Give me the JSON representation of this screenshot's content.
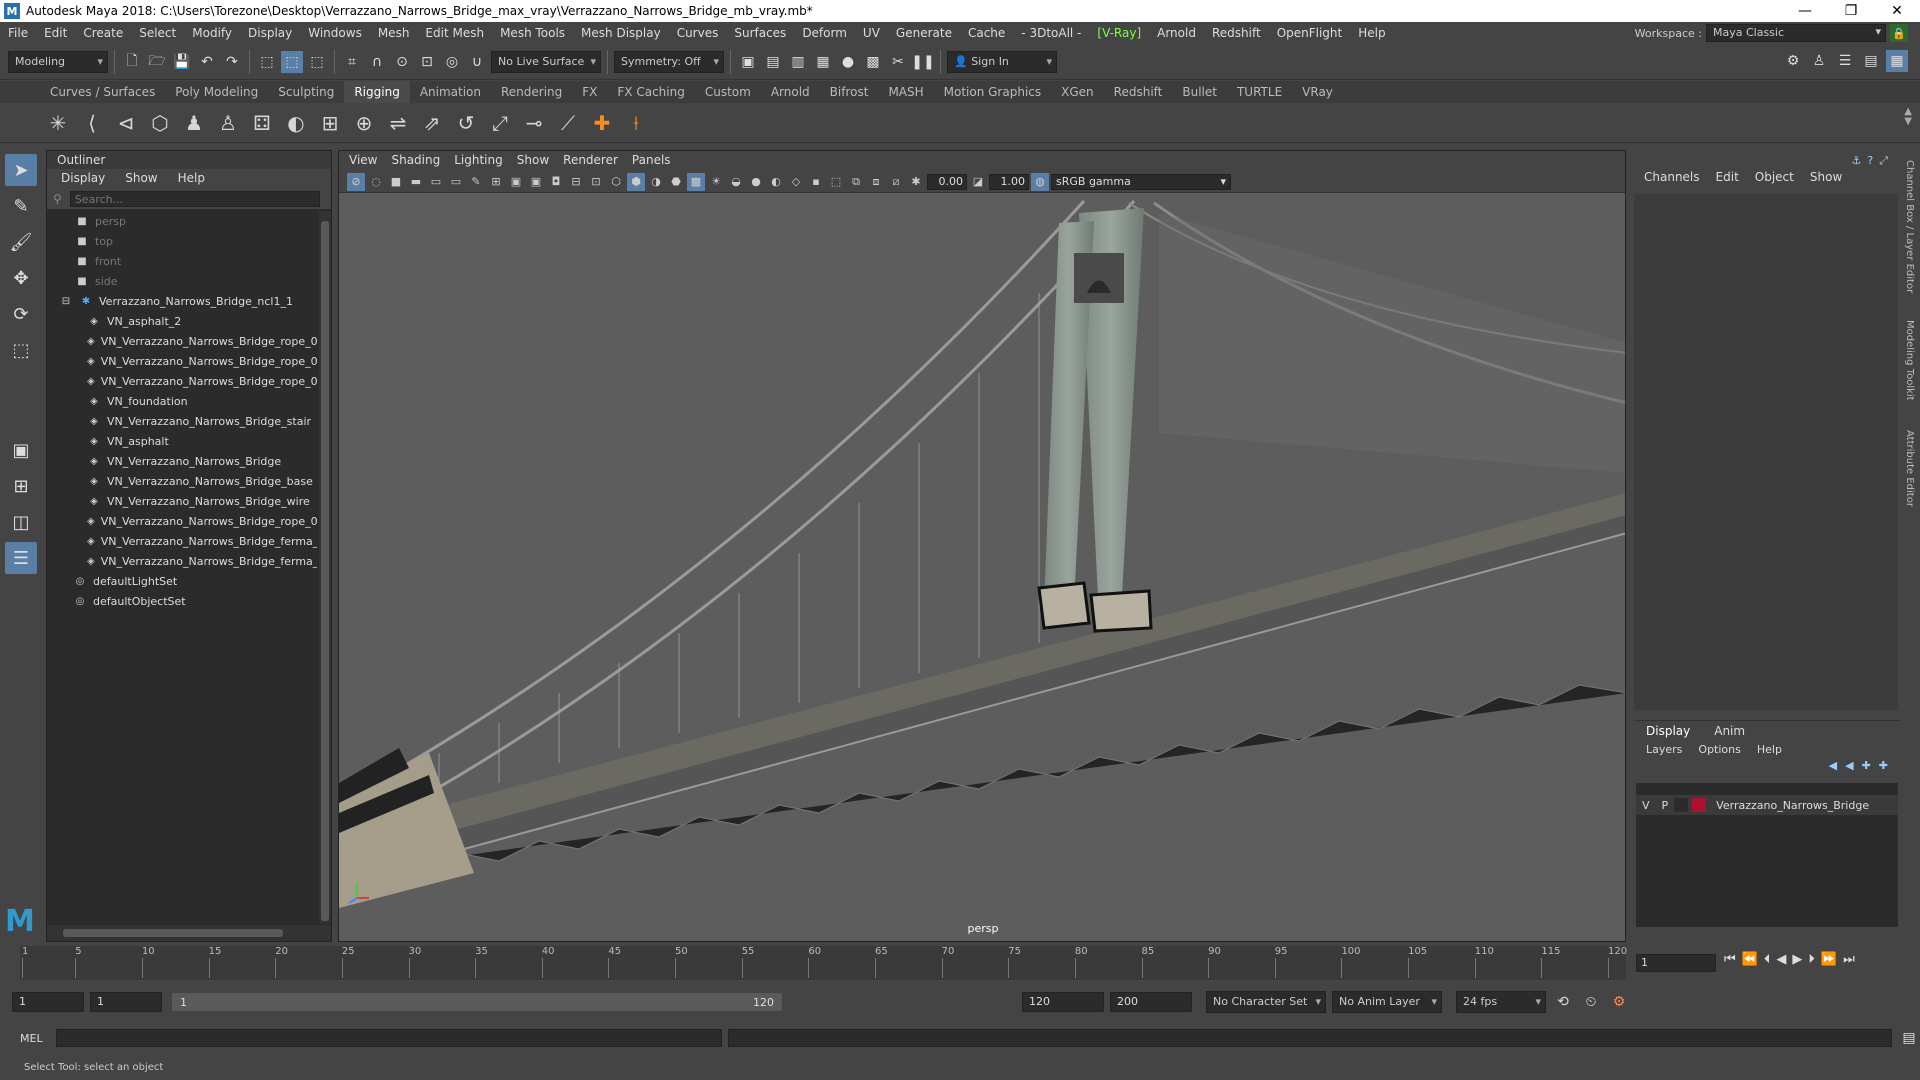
{
  "window": {
    "title": "Autodesk Maya 2018: C:\\Users\\Torezone\\Desktop\\Verrazzano_Narrows_Bridge_max_vray\\Verrazzano_Narrows_Bridge_mb_vray.mb*",
    "app_icon": "M",
    "minimize": "—",
    "restore": "❐",
    "close": "✕"
  },
  "menubar": {
    "items": [
      "File",
      "Edit",
      "Create",
      "Select",
      "Modify",
      "Display",
      "Windows",
      "Mesh",
      "Edit Mesh",
      "Mesh Tools",
      "Mesh Display",
      "Curves",
      "Surfaces",
      "Deform",
      "UV",
      "Generate",
      "Cache",
      "- 3DtoAll -",
      "[V-Ray]",
      "Arnold",
      "Redshift",
      "OpenFlight",
      "Help"
    ],
    "workspace_label": "Workspace :",
    "workspace_value": "Maya Classic"
  },
  "statusline": {
    "mode": "Modeling",
    "live_surface": "No Live Surface",
    "symmetry": "Symmetry: Off",
    "sign_in": "Sign In"
  },
  "shelf": {
    "tabs": [
      "Curves / Surfaces",
      "Poly Modeling",
      "Sculpting",
      "Rigging",
      "Animation",
      "Rendering",
      "FX",
      "FX Caching",
      "Custom",
      "Arnold",
      "Bifrost",
      "MASH",
      "Motion Graphics",
      "XGen",
      "Redshift",
      "Bullet",
      "TURTLE",
      "VRay"
    ],
    "active_tab": "Rigging"
  },
  "outliner": {
    "title": "Outliner",
    "menu": [
      "Display",
      "Show",
      "Help"
    ],
    "search_placeholder": "Search...",
    "cameras": [
      "persp",
      "top",
      "front",
      "side"
    ],
    "group": "Verrazzano_Narrows_Bridge_ncl1_1",
    "children": [
      "VN_asphalt_2",
      "VN_Verrazzano_Narrows_Bridge_rope_0",
      "VN_Verrazzano_Narrows_Bridge_rope_0",
      "VN_Verrazzano_Narrows_Bridge_rope_0",
      "VN_foundation",
      "VN_Verrazzano_Narrows_Bridge_stair",
      "VN_asphalt",
      "VN_Verrazzano_Narrows_Bridge",
      "VN_Verrazzano_Narrows_Bridge_base",
      "VN_Verrazzano_Narrows_Bridge_wire",
      "VN_Verrazzano_Narrows_Bridge_rope_0",
      "VN_Verrazzano_Narrows_Bridge_ferma_",
      "VN_Verrazzano_Narrows_Bridge_ferma_"
    ],
    "sets": [
      "defaultLightSet",
      "defaultObjectSet"
    ]
  },
  "viewport": {
    "menu": [
      "View",
      "Shading",
      "Lighting",
      "Show",
      "Renderer",
      "Panels"
    ],
    "exposure": "0.00",
    "gamma_value": "1.00",
    "color_space": "sRGB gamma",
    "camera_label": "persp"
  },
  "channelbox": {
    "menu": [
      "Channels",
      "Edit",
      "Object",
      "Show"
    ]
  },
  "sidebar_tabs": [
    "Channel Box / Layer Editor",
    "Modeling Toolkit",
    "Attribute Editor"
  ],
  "layer_editor": {
    "tabs": [
      "Display",
      "Anim"
    ],
    "menu": [
      "Layers",
      "Options",
      "Help"
    ],
    "layer": {
      "v": "V",
      "p": "P",
      "name": "Verrazzano_Narrows_Bridge",
      "color": "#b01030"
    }
  },
  "timeline": {
    "ticks": [
      "1",
      "5",
      "10",
      "15",
      "20",
      "25",
      "30",
      "35",
      "40",
      "45",
      "50",
      "55",
      "60",
      "65",
      "70",
      "75",
      "80",
      "85",
      "90",
      "95",
      "100",
      "105",
      "110",
      "115",
      "120"
    ],
    "current_frame": "1"
  },
  "range": {
    "start": "1",
    "playback_start": "1",
    "bar_start": "1",
    "bar_end": "120",
    "playback_end": "120",
    "end": "200",
    "character_set": "No Character Set",
    "anim_layer": "No Anim Layer",
    "fps": "24 fps"
  },
  "cmdline": {
    "label": "MEL"
  },
  "helpline": {
    "text": "Select Tool: select an object"
  }
}
